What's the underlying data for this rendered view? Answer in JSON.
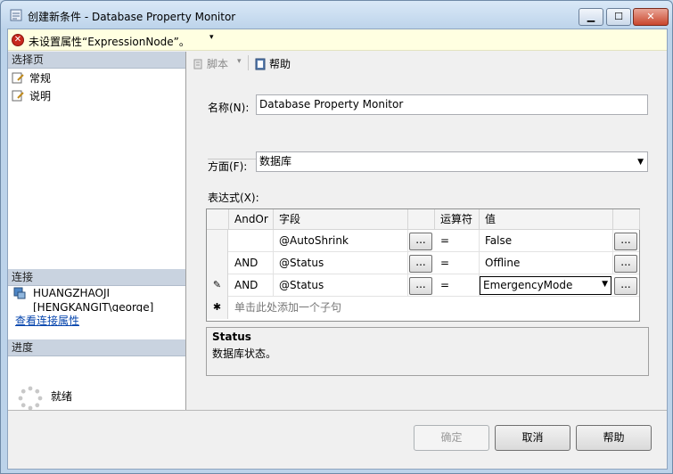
{
  "window": {
    "title": "创建新条件 - Database Property Monitor",
    "min_glyph": "▁",
    "max_glyph": "☐",
    "close_glyph": "✕"
  },
  "warning": {
    "icon_glyph": "✕",
    "text": "未设置属性“ExpressionNode”。",
    "dropdown_glyph": "▾"
  },
  "left": {
    "select_page_header": "选择页",
    "pages": [
      {
        "label": "常规",
        "icon": "page-wrench-icon"
      },
      {
        "label": "说明",
        "icon": "page-wrench-icon"
      }
    ],
    "connection_header": "连接",
    "connection_server": "HUANGZHAOJI",
    "connection_user": "[HENGKANGIT\\george]",
    "connection_link": "查看连接属性",
    "progress_header": "进度",
    "progress_status": "就绪"
  },
  "toolbar": {
    "script_label": "脚本",
    "script_caret": "▾",
    "help_label": "帮助"
  },
  "form": {
    "name_label": "名称(N):",
    "name_value": "Database Property Monitor",
    "facet_label": "方面(F):",
    "facet_value": "数据库",
    "facet_arrow": "▼",
    "expression_label": "表达式(X):"
  },
  "grid": {
    "headers": {
      "andor": "AndOr",
      "field": "字段",
      "operator": "运算符",
      "value": "值"
    },
    "rows": [
      {
        "selector": "",
        "andor": "",
        "field": "@AutoShrink",
        "operator": "=",
        "value": "False"
      },
      {
        "selector": "",
        "andor": "AND",
        "field": "@Status",
        "operator": "=",
        "value": "Offline"
      },
      {
        "selector": "✎",
        "andor": "AND",
        "field": "@Status",
        "operator": "=",
        "value": "EmergencyMode"
      }
    ],
    "ellipsis": "...",
    "combo_arrow": "▼",
    "new_row_marker": "✱",
    "new_row_text": "单击此处添加一个子句"
  },
  "description": {
    "title": "Status",
    "text": "数据库状态。"
  },
  "buttons": {
    "ok": "确定",
    "cancel": "取消",
    "help": "帮助"
  },
  "colors": {
    "title_bar": "#bcd3ea",
    "warning_bg": "#ffffe1",
    "section_header": "#c9d3e0",
    "link": "#0645ad",
    "close_button": "#c9462c"
  }
}
